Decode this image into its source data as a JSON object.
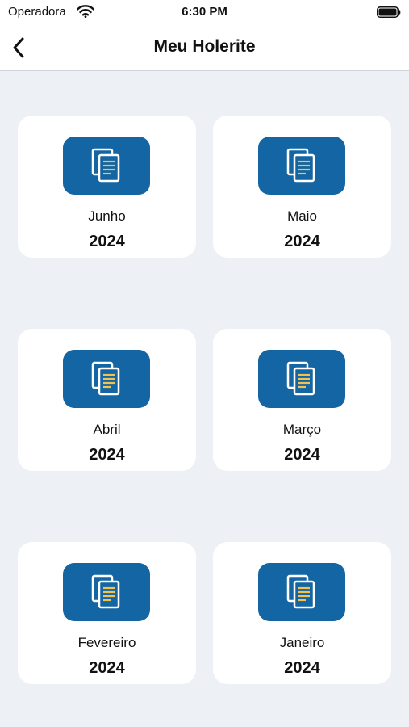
{
  "status_bar": {
    "carrier": "Operadora",
    "time": "6:30 PM",
    "icons": [
      "wifi-icon",
      "battery-icon"
    ]
  },
  "nav": {
    "back_icon": "chevron-left-icon",
    "title": "Meu Holerite"
  },
  "colors": {
    "accent": "#1465a3",
    "doc_lines": "#f2c14e",
    "background": "#edf0f5"
  },
  "payslips": [
    {
      "month": "Junho",
      "year": "2024",
      "icon": "documents-icon"
    },
    {
      "month": "Maio",
      "year": "2024",
      "icon": "documents-icon"
    },
    {
      "month": "Abril",
      "year": "2024",
      "icon": "documents-icon"
    },
    {
      "month": "Março",
      "year": "2024",
      "icon": "documents-icon"
    },
    {
      "month": "Fevereiro",
      "year": "2024",
      "icon": "documents-icon"
    },
    {
      "month": "Janeiro",
      "year": "2024",
      "icon": "documents-icon"
    }
  ]
}
